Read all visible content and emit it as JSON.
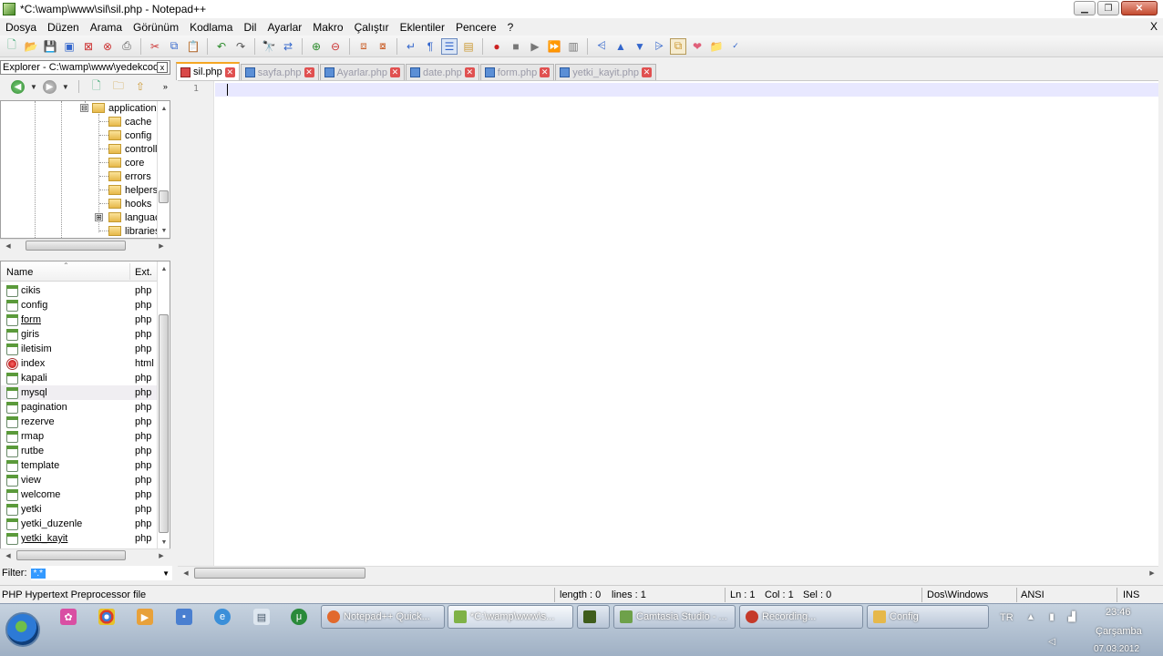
{
  "window": {
    "title": "*C:\\wamp\\www\\sil\\sil.php - Notepad++",
    "minimize_label": "▁",
    "maximize_label": "❐",
    "close_label": "✕"
  },
  "menu": {
    "items": [
      "Dosya",
      "Düzen",
      "Arama",
      "Görünüm",
      "Kodlama",
      "Dil",
      "Ayarlar",
      "Makro",
      "Çalıştır",
      "Eklentiler",
      "Pencere",
      "?"
    ],
    "close_label": "X"
  },
  "toolbar": {
    "icons": [
      "new-file-icon",
      "open-file-icon",
      "save-icon",
      "save-all-icon",
      "close-icon",
      "close-all-icon",
      "print-icon",
      "cut-icon",
      "copy-icon",
      "paste-icon",
      "undo-icon",
      "redo-icon",
      "find-icon",
      "replace-icon",
      "zoom-in-icon",
      "zoom-out-icon",
      "sync-v-icon",
      "sync-h-icon",
      "word-wrap-icon",
      "show-all-chars-icon",
      "indent-guide-icon",
      "document-map-icon",
      "record-macro-icon",
      "stop-macro-icon",
      "play-macro-icon",
      "run-macro-multiple-icon",
      "save-macro-icon",
      "collapse-icon",
      "up-icon",
      "down-icon",
      "expand-icon",
      "doc-switcher-icon",
      "favorite-icon",
      "explorer-icon",
      "spell-check-icon"
    ]
  },
  "explorer": {
    "header": "Explorer - C:\\wamp\\www\\yedekcod...",
    "close_label": "x",
    "tree": [
      {
        "label": "application",
        "expander": "⊟"
      },
      {
        "label": "cache"
      },
      {
        "label": "config"
      },
      {
        "label": "controll"
      },
      {
        "label": "core"
      },
      {
        "label": "errors"
      },
      {
        "label": "helpers"
      },
      {
        "label": "hooks"
      },
      {
        "label": "languac",
        "expander": "⊞"
      },
      {
        "label": "libraries"
      }
    ],
    "list_columns": {
      "name": "Name",
      "ext": "Ext."
    },
    "files": [
      {
        "name": "cikis",
        "ext": "php",
        "type": "php"
      },
      {
        "name": "config",
        "ext": "php",
        "type": "php"
      },
      {
        "name": "form",
        "ext": "php",
        "type": "php",
        "underlined": true
      },
      {
        "name": "giris",
        "ext": "php",
        "type": "php"
      },
      {
        "name": "iletisim",
        "ext": "php",
        "type": "php"
      },
      {
        "name": "index",
        "ext": "html",
        "type": "html"
      },
      {
        "name": "kapali",
        "ext": "php",
        "type": "php"
      },
      {
        "name": "mysql",
        "ext": "php",
        "type": "php",
        "hover": true
      },
      {
        "name": "pagination",
        "ext": "php",
        "type": "php"
      },
      {
        "name": "rezerve",
        "ext": "php",
        "type": "php"
      },
      {
        "name": "rmap",
        "ext": "php",
        "type": "php"
      },
      {
        "name": "rutbe",
        "ext": "php",
        "type": "php"
      },
      {
        "name": "template",
        "ext": "php",
        "type": "php"
      },
      {
        "name": "view",
        "ext": "php",
        "type": "php"
      },
      {
        "name": "welcome",
        "ext": "php",
        "type": "php"
      },
      {
        "name": "yetki",
        "ext": "php",
        "type": "php"
      },
      {
        "name": "yetki_duzenle",
        "ext": "php",
        "type": "php"
      },
      {
        "name": "yetki_kayit",
        "ext": "php",
        "type": "php",
        "underlined": true
      }
    ],
    "filter_label": "Filter:",
    "filter_value": "*.*"
  },
  "tabs": [
    {
      "label": "sil.php",
      "active": true
    },
    {
      "label": "sayfa.php"
    },
    {
      "label": "Ayarlar.php"
    },
    {
      "label": "date.php"
    },
    {
      "label": "form.php"
    },
    {
      "label": "yetki_kayit.php"
    }
  ],
  "editor": {
    "line_numbers": [
      "1"
    ]
  },
  "status": {
    "file_type": "PHP Hypertext Preprocessor file",
    "length": "length : 0",
    "lines": "lines : 1",
    "ln": "Ln : 1",
    "col": "Col : 1",
    "sel": "Sel : 0",
    "eol": "Dos\\Windows",
    "encoding": "ANSI",
    "mode": "INS"
  },
  "taskbar": {
    "buttons": [
      {
        "label": "Notepad++ Quick...",
        "icon": "firefox-icon",
        "color": "#e2692c"
      },
      {
        "label": "*C:\\wamp\\www\\s...",
        "icon": "notepadpp-icon",
        "color": "#7fb247",
        "active": true
      },
      {
        "label": "",
        "icon": "dreamweaver-icon",
        "color": "#3f5d1c"
      },
      {
        "label": "Camtasia Studio - ...",
        "icon": "camtasia-icon",
        "color": "#6ea14a"
      },
      {
        "label": "Recording...",
        "icon": "recording-icon",
        "color": "#c53a2a"
      },
      {
        "label": "Config",
        "icon": "folder-icon",
        "color": "#e6b84a"
      }
    ],
    "language": "TR",
    "time": "23:46",
    "day": "Çarşamba",
    "date": "07.03.2012"
  }
}
